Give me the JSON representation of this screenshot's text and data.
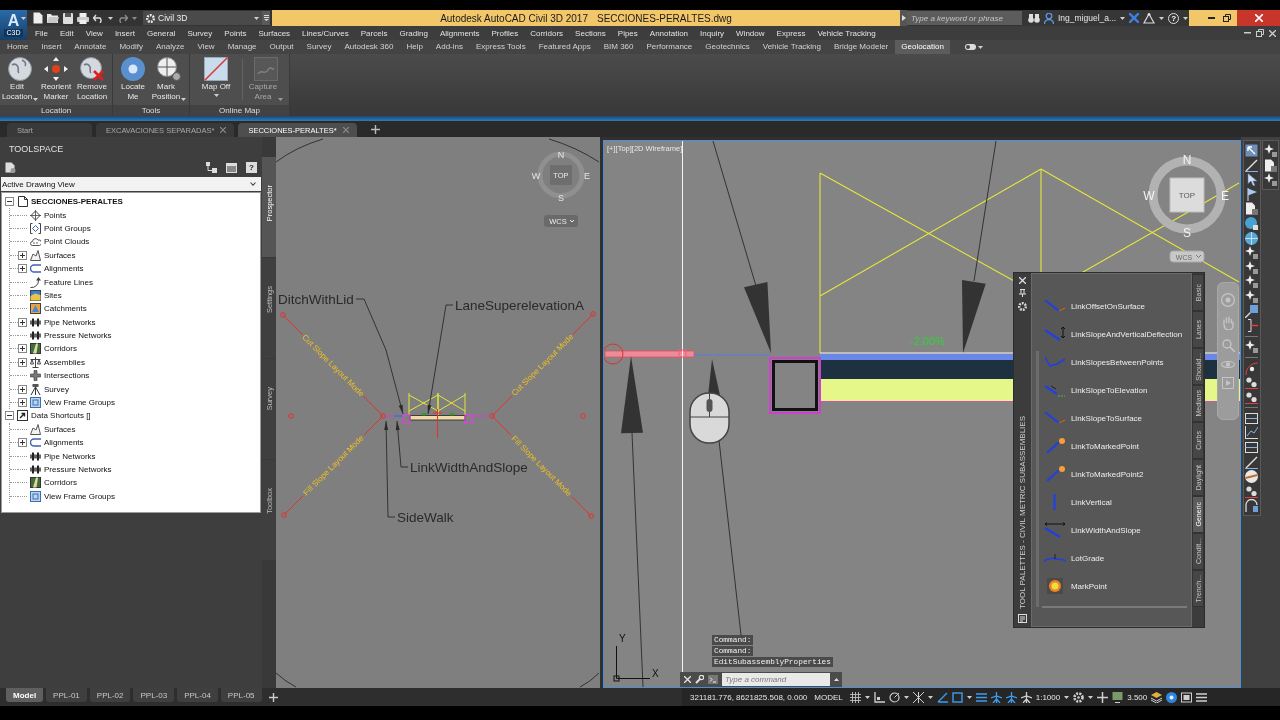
{
  "app_button": {
    "letter": "A",
    "caption": "C3D"
  },
  "quick_access": {
    "workspace": "Civil 3D"
  },
  "title": {
    "app": "Autodesk AutoCAD Civil 3D 2017",
    "file": "SECCIONES-PERALTES.dwg"
  },
  "search": {
    "placeholder": "Type a keyword or phrase"
  },
  "user": {
    "name": "Ing_miguel_a..."
  },
  "help": {
    "label": "?"
  },
  "menu_bar": [
    "File",
    "Edit",
    "View",
    "Insert",
    "General",
    "Survey",
    "Points",
    "Surfaces",
    "Lines/Curves",
    "Parcels",
    "Grading",
    "Alignments",
    "Profiles",
    "Corridors",
    "Sections",
    "Pipes",
    "Annotation",
    "Inquiry",
    "Window",
    "Express",
    "Vehicle Tracking"
  ],
  "ribbon_tabs": [
    {
      "label": "Home",
      "selected": false
    },
    {
      "label": "Insert",
      "selected": false
    },
    {
      "label": "Annotate",
      "selected": false
    },
    {
      "label": "Modify",
      "selected": false
    },
    {
      "label": "Analyze",
      "selected": false
    },
    {
      "label": "View",
      "selected": false
    },
    {
      "label": "Manage",
      "selected": false
    },
    {
      "label": "Output",
      "selected": false
    },
    {
      "label": "Survey",
      "selected": false
    },
    {
      "label": "Autodesk 360",
      "selected": false
    },
    {
      "label": "Help",
      "selected": false
    },
    {
      "label": "Add-ins",
      "selected": false
    },
    {
      "label": "Express Tools",
      "selected": false
    },
    {
      "label": "Featured Apps",
      "selected": false
    },
    {
      "label": "BIM 360",
      "selected": false
    },
    {
      "label": "Performance",
      "selected": false
    },
    {
      "label": "Geotechnics",
      "selected": false
    },
    {
      "label": "Vehicle Tracking",
      "selected": false
    },
    {
      "label": "Bridge Modeler",
      "selected": false
    },
    {
      "label": "Geolocation",
      "selected": true
    }
  ],
  "ribbon_panels": [
    {
      "title": "Location",
      "tools": [
        {
          "label": "Edit Location",
          "kind": "globe",
          "dropdown": true,
          "disabled": false
        },
        {
          "label": "Reorient Marker",
          "kind": "marker",
          "dropdown": false,
          "disabled": false
        },
        {
          "label": "Remove Location",
          "kind": "globe-remove",
          "dropdown": false,
          "disabled": false
        }
      ]
    },
    {
      "title": "Tools",
      "tools": [
        {
          "label": "Locate Me",
          "kind": "locate",
          "dropdown": false,
          "disabled": false
        },
        {
          "label": "Mark Position",
          "kind": "mark",
          "dropdown": true,
          "disabled": false
        }
      ]
    },
    {
      "title": "Online Map",
      "tools": [
        {
          "label": "Map Off",
          "kind": "map",
          "dropdown": true,
          "disabled": false
        },
        {
          "label": "Capture Area",
          "kind": "capture",
          "dropdown": true,
          "disabled": true
        }
      ]
    }
  ],
  "document_tabs": [
    {
      "label": "Start",
      "selected": false,
      "closable": false
    },
    {
      "label": "EXCAVACIONES SEPARADAS*",
      "selected": false,
      "closable": true
    },
    {
      "label": "SECCIONES-PERALTES*",
      "selected": true,
      "closable": true
    }
  ],
  "toolspace": {
    "title": "TOOLSPACE",
    "help": "?",
    "view": "Active Drawing View",
    "tree": [
      {
        "label": "SECCIONES-PERALTES",
        "kind": "drawing",
        "expanded": true,
        "children": [
          {
            "label": "Points",
            "kind": "points"
          },
          {
            "label": "Point Groups",
            "kind": "point-groups"
          },
          {
            "label": "Point Clouds",
            "kind": "point-clouds"
          },
          {
            "label": "Surfaces",
            "kind": "surfaces",
            "expanded": false
          },
          {
            "label": "Alignments",
            "kind": "alignments",
            "expanded": false
          },
          {
            "label": "Feature Lines",
            "kind": "feature-lines"
          },
          {
            "label": "Sites",
            "kind": "sites"
          },
          {
            "label": "Catchments",
            "kind": "catchments"
          },
          {
            "label": "Pipe Networks",
            "kind": "pipes",
            "expanded": false
          },
          {
            "label": "Pressure Networks",
            "kind": "pipes"
          },
          {
            "label": "Corridors",
            "kind": "corridors",
            "expanded": false
          },
          {
            "label": "Assemblies",
            "kind": "assemblies",
            "expanded": false
          },
          {
            "label": "Intersections",
            "kind": "intersections"
          },
          {
            "label": "Survey",
            "kind": "survey",
            "expanded": false
          },
          {
            "label": "View Frame Groups",
            "kind": "view-frames",
            "expanded": false
          }
        ]
      },
      {
        "label": "Data Shortcuts []",
        "kind": "shortcuts",
        "expanded": true,
        "children": [
          {
            "label": "Surfaces",
            "kind": "surfaces"
          },
          {
            "label": "Alignments",
            "kind": "alignments",
            "expanded": false
          },
          {
            "label": "Pipe Networks",
            "kind": "pipes"
          },
          {
            "label": "Pressure Networks",
            "kind": "pipes"
          },
          {
            "label": "Corridors",
            "kind": "corridors"
          },
          {
            "label": "View Frame Groups",
            "kind": "view-frames"
          }
        ]
      }
    ],
    "side_tabs": [
      {
        "label": "Prospector",
        "selected": true
      },
      {
        "label": "Settings",
        "selected": false
      },
      {
        "label": "Survey",
        "selected": false
      },
      {
        "label": "Toolbox",
        "selected": false
      }
    ]
  },
  "left_viewport": {
    "viewcube": {
      "north": "N",
      "west": "W",
      "east": "E",
      "south": "S",
      "face": "TOP",
      "ucs": "WCS"
    },
    "callouts": [
      "DitchWithLid",
      "LaneSuperelevationA",
      "LinkWidthAndSlope",
      "SideWalk"
    ],
    "slope_labels": [
      "Cut Slope Layout Mode",
      "Cut Slope Layout Mode",
      "Fill Slope Layout Mode",
      "Fill Slope Layout Mode"
    ]
  },
  "right_viewport": {
    "label": "[+][Top][2D Wireframe]",
    "grade": "-2.00%",
    "viewcube": {
      "north": "N",
      "west": "W",
      "east": "E",
      "south": "S",
      "face": "TOP",
      "ucs": "WCS"
    },
    "ucs": {
      "y": "Y",
      "x": "X"
    },
    "command_history": [
      "Command:",
      "Command:",
      "EditSubassemblyProperties"
    ],
    "command_line": {
      "placeholder": "Type a command"
    }
  },
  "tool_palette": {
    "title": "TOOL PALETTES - CIVIL METRIC SUBASSEMBLIES",
    "items": [
      {
        "label": "LinkOffsetOnSurface",
        "kind": "link-surface"
      },
      {
        "label": "LinkSlopeAndVerticalDeflection",
        "kind": "link-deflection"
      },
      {
        "label": "LinkSlopesBetweenPoints",
        "kind": "link-polyline"
      },
      {
        "label": "LinkSlopeToElevation",
        "kind": "link-elevation"
      },
      {
        "label": "LinkSlopeToSurface",
        "kind": "link-surface"
      },
      {
        "label": "LinkToMarkedPoint",
        "kind": "link-marked"
      },
      {
        "label": "LinkToMarkedPoint2",
        "kind": "link-marked"
      },
      {
        "label": "LinkVertical",
        "kind": "link-vertical"
      },
      {
        "label": "LinkWidthAndSlope",
        "kind": "link-width"
      },
      {
        "label": "LotGrade",
        "kind": "lot-grade"
      },
      {
        "label": "MarkPoint",
        "kind": "mark-point"
      }
    ],
    "tabs": [
      {
        "label": "Basic",
        "selected": false
      },
      {
        "label": "Lanes",
        "selected": false
      },
      {
        "label": "Should...",
        "selected": false
      },
      {
        "label": "Medians",
        "selected": false
      },
      {
        "label": "Curbs",
        "selected": false
      },
      {
        "label": "Daylight",
        "selected": false
      },
      {
        "label": "Generic",
        "selected": true
      },
      {
        "label": "Condit...",
        "selected": false
      },
      {
        "label": "Trench...",
        "selected": false
      }
    ]
  },
  "layout_tabs": [
    {
      "label": "Model",
      "selected": true
    },
    {
      "label": "PPL-01",
      "selected": false
    },
    {
      "label": "PPL-02",
      "selected": false
    },
    {
      "label": "PPL-03",
      "selected": false
    },
    {
      "label": "PPL-04",
      "selected": false
    },
    {
      "label": "PPL-05",
      "selected": false
    }
  ],
  "status_bar": {
    "coordinates": "321181.776, 8621825.508, 0.000",
    "space": "MODEL",
    "scale": "1:1000",
    "readout": "3.500"
  }
}
